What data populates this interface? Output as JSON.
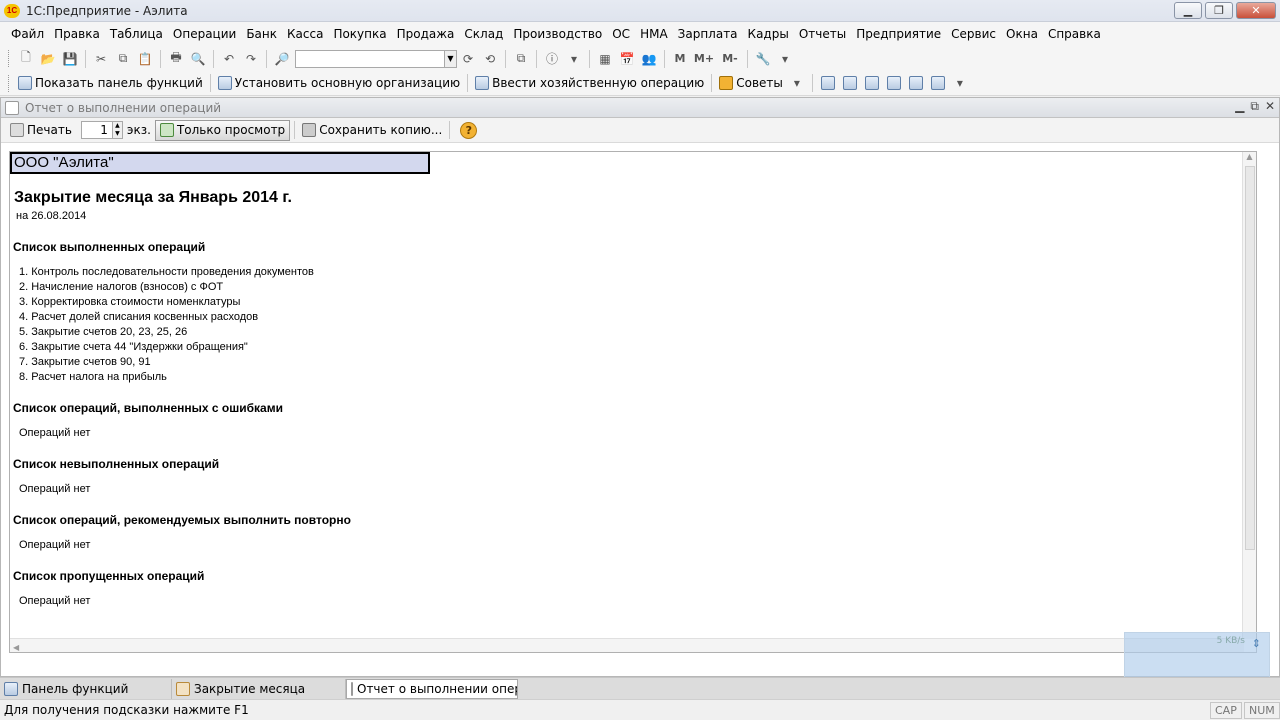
{
  "app": {
    "title": "1С:Предприятие - Аэлита",
    "logo": "1С"
  },
  "menu": [
    {
      "label": "Файл",
      "name": "menu-file"
    },
    {
      "label": "Правка",
      "name": "menu-edit"
    },
    {
      "label": "Таблица",
      "name": "menu-table"
    },
    {
      "label": "Операции",
      "name": "menu-operations"
    },
    {
      "label": "Банк",
      "name": "menu-bank"
    },
    {
      "label": "Касса",
      "name": "menu-cash"
    },
    {
      "label": "Покупка",
      "name": "menu-purchase"
    },
    {
      "label": "Продажа",
      "name": "menu-sale"
    },
    {
      "label": "Склад",
      "name": "menu-warehouse"
    },
    {
      "label": "Производство",
      "name": "menu-production"
    },
    {
      "label": "ОС",
      "name": "menu-os"
    },
    {
      "label": "НМА",
      "name": "menu-nma"
    },
    {
      "label": "Зарплата",
      "name": "menu-salary"
    },
    {
      "label": "Кадры",
      "name": "menu-hr"
    },
    {
      "label": "Отчеты",
      "name": "menu-reports"
    },
    {
      "label": "Предприятие",
      "name": "menu-enterprise"
    },
    {
      "label": "Сервис",
      "name": "menu-service"
    },
    {
      "label": "Окна",
      "name": "menu-windows"
    },
    {
      "label": "Справка",
      "name": "menu-help"
    }
  ],
  "toolbar1": {
    "m": "M",
    "m_plus": "M+",
    "m_minus": "M-"
  },
  "toolbar2": {
    "show_panel": "Показать панель функций",
    "set_org": "Установить основную организацию",
    "enter_op": "Ввести хозяйственную операцию",
    "tips": "Советы"
  },
  "document": {
    "title": "Отчет о выполнении операций",
    "toolbar": {
      "print": "Печать",
      "copies": "1",
      "copies_unit": "экз.",
      "view_only": "Только просмотр",
      "save_copy": "Сохранить копию...",
      "help": "?"
    }
  },
  "report": {
    "org": "ООО \"Аэлита\"",
    "heading": "Закрытие месяца за Январь 2014 г.",
    "date": "на 26.08.2014",
    "done_title": "Список выполненных операций",
    "done": [
      "1. Контроль последовательности проведения документов",
      "2. Начисление налогов (взносов) с ФОТ",
      "3. Корректировка стоимости номенклатуры",
      "4. Расчет долей списания косвенных расходов",
      "5. Закрытие счетов 20, 23, 25, 26",
      "6. Закрытие счета 44 \"Издержки обращения\"",
      "7. Закрытие счетов 90, 91",
      "8. Расчет налога на прибыль"
    ],
    "errors_title": "Список операций, выполненных с ошибками",
    "errors_value": "Операций нет",
    "not_done_title": "Список невыполненных операций",
    "not_done_value": "Операций нет",
    "repeat_title": "Список операций, рекомендуемых выполнить повторно",
    "repeat_value": "Операций нет",
    "skipped_title": "Список пропущенных операций",
    "skipped_value": "Операций нет"
  },
  "tray": {
    "speed": "5 KB/s"
  },
  "taskbar": [
    {
      "label": "Панель функций",
      "icon": "function-panel-icon",
      "active": false
    },
    {
      "label": "Закрытие месяца",
      "icon": "calendar-icon",
      "active": false
    },
    {
      "label": "Отчет о выполнении опера...",
      "icon": "document-icon",
      "active": true
    }
  ],
  "status": {
    "hint": "Для получения подсказки нажмите F1",
    "cap": "CAP",
    "num": "NUM"
  }
}
